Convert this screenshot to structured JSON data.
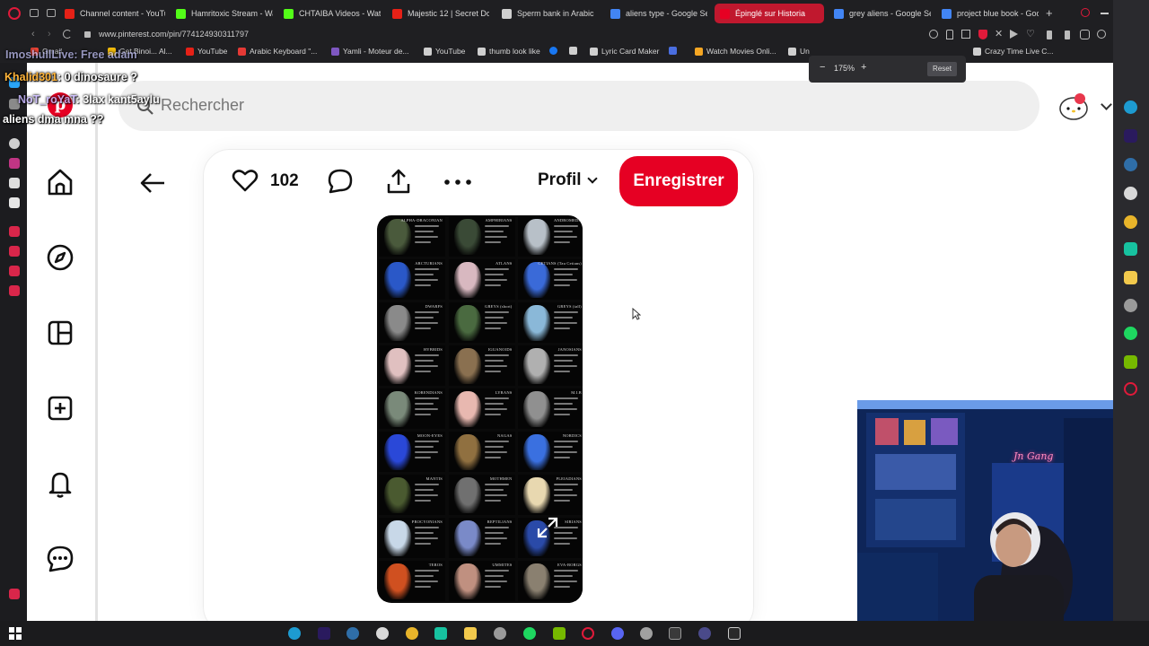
{
  "browser": {
    "tabs": [
      {
        "label": "Channel content - YouTu",
        "color": "#e62117"
      },
      {
        "label": "Hamritoxic Stream - Wa",
        "color": "#53fc18"
      },
      {
        "label": "CHTAIBA Videos - Watc",
        "color": "#53fc18"
      },
      {
        "label": "Majestic 12 | Secret Doc",
        "color": "#e62117"
      },
      {
        "label": "Sperm bank in Arabic",
        "color": "#cfcfcf"
      },
      {
        "label": "aliens type - Google Se",
        "color": "#4285f4"
      },
      {
        "label": "Épinglé sur Historia",
        "color": "#e60023"
      },
      {
        "label": "grey aliens - Google Se",
        "color": "#4285f4"
      },
      {
        "label": "project blue book - Goo",
        "color": "#4285f4"
      }
    ],
    "new_tab": "+",
    "url": "www.pinterest.com/pin/774124930311797",
    "bookmarks": [
      {
        "label": "Gmail",
        "color": "#ea4335"
      },
      {
        "label": "Get Binoi... Al...",
        "color": "#f0b90b"
      },
      {
        "label": "YouTube",
        "color": "#e62117"
      },
      {
        "label": "Arabic Keyboard \"...",
        "color": "#e53935"
      },
      {
        "label": "Yamli - Moteur de...",
        "color": "#7e57c2"
      },
      {
        "label": "YouTube",
        "color": "#cfcfcf"
      },
      {
        "label": "thumb look like",
        "color": "#cfcfcf"
      },
      {
        "label": "",
        "color": "#1877f2"
      },
      {
        "label": "Lyric Card Maker",
        "color": "#cfcfcf"
      },
      {
        "label": "",
        "color": "#4a6ee0"
      },
      {
        "label": "Watch Movies Onli...",
        "color": "#f5a623"
      },
      {
        "label": "Un",
        "color": "#cfcfcf"
      },
      {
        "label": "Crazy Time Live C...",
        "color": "#cfcfcf"
      }
    ],
    "zoom": {
      "minus": "−",
      "value": "175%",
      "plus": "+",
      "reset": "Reset"
    }
  },
  "chat": [
    {
      "user": "ImoshullLive",
      "message": ": Free adam"
    },
    {
      "user": "Khalid301",
      "message": ": 0 dinosaure ?"
    },
    {
      "user": "NoT_roYaT",
      "message": ": 3lax kant5aylu"
    },
    {
      "user": "",
      "message": "aliens dma mna ??"
    }
  ],
  "pinterest": {
    "search_placeholder": "Rechercher",
    "nav_icons": [
      "home-icon",
      "explore-icon",
      "board-icon",
      "create-icon",
      "notifications-icon",
      "messages-icon"
    ],
    "pin": {
      "likes": "102",
      "profile_label": "Profil",
      "save_label": "Enregistrer",
      "accent": "#e60023",
      "grid_cells": [
        {
          "caption": "ALPHA-DRACONIAN",
          "color": "#4a5a3c"
        },
        {
          "caption": "AMPHIBIANS",
          "color": "#3a4a36"
        },
        {
          "caption": "ANDROMEDA",
          "color": "#b8c0c8"
        },
        {
          "caption": "ARCTURIANS",
          "color": "#2a58c8"
        },
        {
          "caption": "ATLANS",
          "color": "#d8b8c0"
        },
        {
          "caption": "CETIANS (Tau Cetians)",
          "color": "#3a6ad8"
        },
        {
          "caption": "DWARFS",
          "color": "#8a8a8a"
        },
        {
          "caption": "GREYS (short)",
          "color": "#4a6a40"
        },
        {
          "caption": "GREYS (tall)",
          "color": "#8ab8d8"
        },
        {
          "caption": "HYBRIDS",
          "color": "#e0c0c0"
        },
        {
          "caption": "IGUANOIDS",
          "color": "#8a7050"
        },
        {
          "caption": "JANOSIANS",
          "color": "#b0b0b0"
        },
        {
          "caption": "KORENDIANS",
          "color": "#7a8a7a"
        },
        {
          "caption": "LYRANS",
          "color": "#e8b8b0"
        },
        {
          "caption": "M.I.B",
          "color": "#909090"
        },
        {
          "caption": "MOON-EYES",
          "color": "#2a48d8"
        },
        {
          "caption": "NAGAS",
          "color": "#907040"
        },
        {
          "caption": "NORDICS",
          "color": "#3a70e0"
        },
        {
          "caption": "MANTIS",
          "color": "#4a5a30"
        },
        {
          "caption": "MOTHMEN",
          "color": "#707070"
        },
        {
          "caption": "PLEIADIANS",
          "color": "#e8d8b0"
        },
        {
          "caption": "PROCYONIANS",
          "color": "#c8d8e8"
        },
        {
          "caption": "REPTILIANS",
          "color": "#7a8ac8"
        },
        {
          "caption": "SIRIANS",
          "color": "#2a4aa8"
        },
        {
          "caption": "TEROS",
          "color": "#d05020"
        },
        {
          "caption": "UMMITES",
          "color": "#c09080"
        },
        {
          "caption": "EVA-BORGS",
          "color": "#8a8070"
        }
      ]
    }
  },
  "webcam": {
    "neon_sign": "Jn Gang"
  }
}
